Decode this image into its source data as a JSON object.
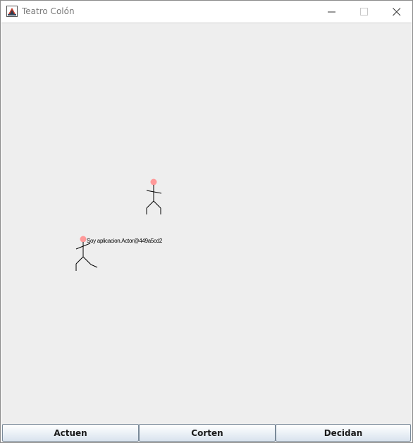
{
  "window": {
    "title": "Teatro Colón",
    "icon": "java-app-icon",
    "controls": [
      "minimize-icon",
      "maximize-icon",
      "close-icon"
    ]
  },
  "stage": {
    "background": "#eeeeee",
    "actors": [
      {
        "name": "actor-1",
        "head_color": "#ff9999",
        "label": ""
      },
      {
        "name": "actor-2",
        "head_color": "#ff9999",
        "label": "Soy aplicacion.Actor@449a5cd2"
      }
    ]
  },
  "buttons": {
    "actuen": "Actuen",
    "corten": "Corten",
    "decidan": "Decidan"
  }
}
